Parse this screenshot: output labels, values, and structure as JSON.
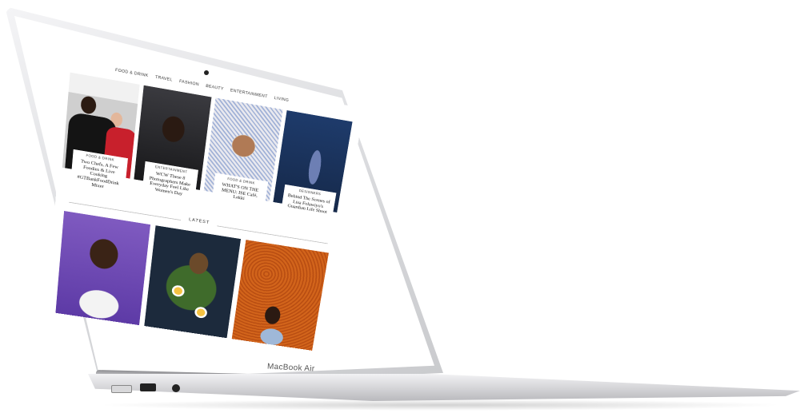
{
  "device": {
    "brand_label": "MacBook Air"
  },
  "site": {
    "nav": [
      "FOOD & DRINK",
      "TRAVEL",
      "FASHION",
      "BEAUTY",
      "ENTERTAINMENT",
      "LIVING"
    ],
    "featured": [
      {
        "category": "FOOD & DRINK",
        "title": "Two Chefs, A Few Foodies & Live Cooking #GTBankFoodDrink Mixer",
        "image": "chefs-photo"
      },
      {
        "category": "ENTERTAINMENT",
        "title": "WCW These 8 Photographers Make Everyday Feel Like Women's Day",
        "image": "woman-portrait-photo"
      },
      {
        "category": "FOOD & DRINK",
        "title": "WHAT'S ON THE MENU: ISE Café, Lekki",
        "image": "drink-photo"
      },
      {
        "category": "DESIGNERS",
        "title": "Behind The Scenes of Lisa Folawiyo's Guardian Life Shoot",
        "image": "dress-photo"
      }
    ],
    "latest_label": "LATEST",
    "latest": [
      {
        "image": "portrait-photo"
      },
      {
        "image": "scotch-eggs-photo"
      },
      {
        "image": "beans-portrait-photo"
      }
    ]
  }
}
